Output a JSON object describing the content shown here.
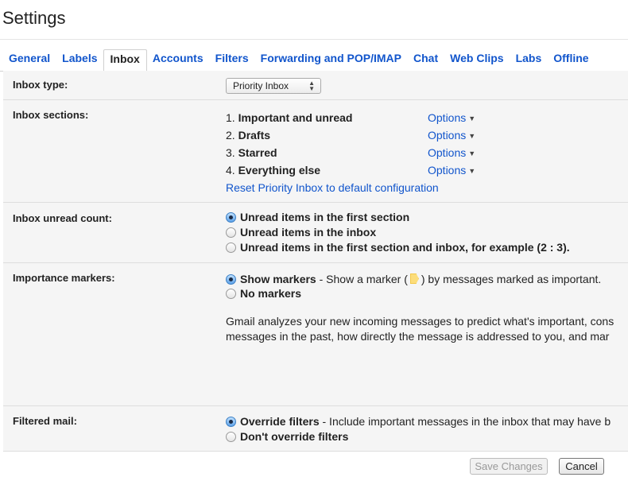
{
  "page": {
    "title": "Settings"
  },
  "tabs": [
    {
      "label": "General"
    },
    {
      "label": "Labels"
    },
    {
      "label": "Inbox",
      "active": true
    },
    {
      "label": "Accounts"
    },
    {
      "label": "Filters"
    },
    {
      "label": "Forwarding and POP/IMAP"
    },
    {
      "label": "Chat"
    },
    {
      "label": "Web Clips"
    },
    {
      "label": "Labs"
    },
    {
      "label": "Offline"
    }
  ],
  "inbox_type": {
    "label": "Inbox type:",
    "selected": "Priority Inbox"
  },
  "inbox_sections": {
    "label": "Inbox sections:",
    "items": [
      {
        "number": "1.",
        "name": "Important and unread",
        "options": "Options"
      },
      {
        "number": "2.",
        "name": "Drafts",
        "options": "Options"
      },
      {
        "number": "3.",
        "name": "Starred",
        "options": "Options"
      },
      {
        "number": "4.",
        "name": "Everything else",
        "options": "Options"
      }
    ],
    "reset_link": "Reset Priority Inbox to default configuration"
  },
  "unread_count": {
    "label": "Inbox unread count:",
    "options": [
      {
        "text": "Unread items in the first section",
        "checked": true
      },
      {
        "text": "Unread items in the inbox",
        "checked": false
      },
      {
        "text": "Unread items in the first section and inbox, for example (2 : 3).",
        "checked": false
      }
    ]
  },
  "importance_markers": {
    "label": "Importance markers:",
    "show_label": "Show markers",
    "show_desc_before": " - Show a marker (",
    "show_desc_after": ") by messages marked as important.",
    "no_label": "No markers",
    "show_checked": true,
    "desc_line1": "Gmail analyzes your new incoming messages to predict what's important, cons",
    "desc_line2": "messages in the past, how directly the message is addressed to you, and mar"
  },
  "filtered_mail": {
    "label": "Filtered mail:",
    "override_label": "Override filters",
    "override_desc": " - Include important messages in the inbox that may have b",
    "dont_label": "Don't override filters",
    "override_checked": true
  },
  "buttons": {
    "save": "Save Changes",
    "cancel": "Cancel"
  },
  "colors": {
    "link": "#1155cc",
    "panel_bg": "#f5f5f5",
    "marker": "#fcdd7a"
  }
}
